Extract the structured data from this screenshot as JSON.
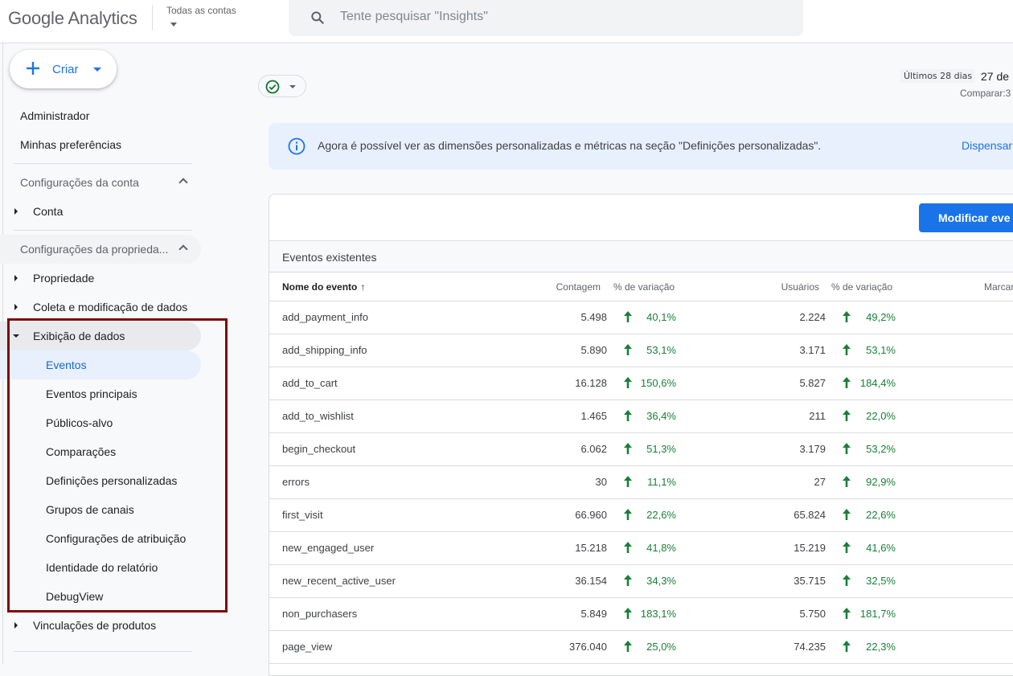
{
  "header": {
    "app_title": "Google Analytics",
    "account_selector": "Todas as contas",
    "search_placeholder": "Tente pesquisar \"Insights\""
  },
  "sidebar": {
    "create_label": "Criar",
    "top_items": [
      {
        "label": "Administrador"
      },
      {
        "label": "Minhas preferências"
      }
    ],
    "account_section": {
      "label": "Configurações da conta",
      "items": [
        {
          "label": "Conta"
        }
      ]
    },
    "property_section": {
      "label": "Configurações da proprieda...",
      "items": [
        {
          "label": "Propriedade"
        },
        {
          "label": "Coleta e modificação de dados"
        },
        {
          "label": "Exibição de dados",
          "expanded": true
        }
      ],
      "data_display_children": [
        {
          "label": "Eventos",
          "active": true
        },
        {
          "label": "Eventos principais"
        },
        {
          "label": "Públicos-alvo"
        },
        {
          "label": "Comparações"
        },
        {
          "label": "Definições personalizadas"
        },
        {
          "label": "Grupos de canais"
        },
        {
          "label": "Configurações de atribuição"
        },
        {
          "label": "Identidade do relatório"
        },
        {
          "label": "DebugView"
        }
      ],
      "after_items": [
        {
          "label": "Vinculações de produtos"
        }
      ]
    }
  },
  "toolbar": {
    "status_icon": "check-circle-icon",
    "date_range_label": "Últimos 28 dias",
    "date_start": "27 de",
    "compare_label": "Comparar:3"
  },
  "banner": {
    "text": "Agora é possível ver as dimensões personalizadas e métricas na seção \"Definições personalizadas\".",
    "dismiss_label": "Dispensar"
  },
  "events_card": {
    "modify_button_label": "Modificar eve",
    "section_title": "Eventos existentes",
    "columns": {
      "name": "Nome do evento",
      "count": "Contagem",
      "count_change": "% de variação",
      "users": "Usuários",
      "users_change": "% de variação",
      "mark": "Marcar"
    },
    "colors": {
      "positive": "#188038",
      "primary": "#1a73e8"
    },
    "rows": [
      {
        "name": "add_payment_info",
        "count": "5.498",
        "count_change": "40,1%",
        "users": "2.224",
        "users_change": "49,2%"
      },
      {
        "name": "add_shipping_info",
        "count": "5.890",
        "count_change": "53,1%",
        "users": "3.171",
        "users_change": "53,1%"
      },
      {
        "name": "add_to_cart",
        "count": "16.128",
        "count_change": "150,6%",
        "users": "5.827",
        "users_change": "184,4%"
      },
      {
        "name": "add_to_wishlist",
        "count": "1.465",
        "count_change": "36,4%",
        "users": "211",
        "users_change": "22,0%"
      },
      {
        "name": "begin_checkout",
        "count": "6.062",
        "count_change": "51,3%",
        "users": "3.179",
        "users_change": "53,2%"
      },
      {
        "name": "errors",
        "count": "30",
        "count_change": "11,1%",
        "users": "27",
        "users_change": "92,9%"
      },
      {
        "name": "first_visit",
        "count": "66.960",
        "count_change": "22,6%",
        "users": "65.824",
        "users_change": "22,6%"
      },
      {
        "name": "new_engaged_user",
        "count": "15.218",
        "count_change": "41,8%",
        "users": "15.219",
        "users_change": "41,6%"
      },
      {
        "name": "new_recent_active_user",
        "count": "36.154",
        "count_change": "34,3%",
        "users": "35.715",
        "users_change": "32,5%"
      },
      {
        "name": "non_purchasers",
        "count": "5.849",
        "count_change": "183,1%",
        "users": "5.750",
        "users_change": "181,7%"
      },
      {
        "name": "page_view",
        "count": "376.040",
        "count_change": "25,0%",
        "users": "74.235",
        "users_change": "22,3%"
      }
    ]
  }
}
